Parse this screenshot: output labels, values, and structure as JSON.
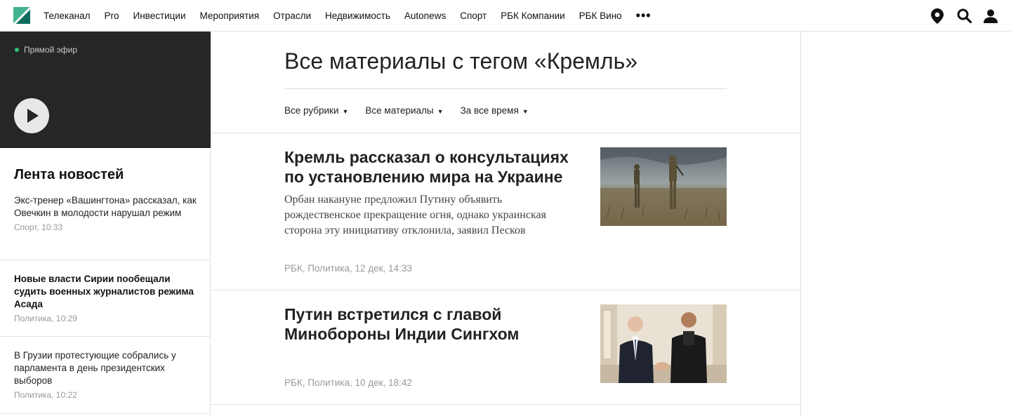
{
  "nav": {
    "items": [
      "Телеканал",
      "Pro",
      "Инвестиции",
      "Мероприятия",
      "Отрасли",
      "Недвижимость",
      "Autonews",
      "Спорт",
      "РБК Компании",
      "РБК Вино"
    ],
    "more": "•••"
  },
  "live": {
    "label": "Прямой эфир"
  },
  "feed": {
    "title": "Лента новостей",
    "items": [
      {
        "title": "Экс-тренер «Вашингтона» рассказал, как Овечкин в молодости нарушал режим",
        "meta": "Спорт, 10:33",
        "bold": false
      },
      {
        "title": "Новые власти Сирии пообещали судить военных журналистов режима Асада",
        "meta": "Политика, 10:29",
        "bold": true
      },
      {
        "title": "В Грузии протестующие собрались у парламента в день президентских выборов",
        "meta": "Политика, 10:22",
        "bold": false
      }
    ]
  },
  "main": {
    "title": "Все материалы с тегом «Кремль»",
    "filters": [
      "Все рубрики",
      "Все материалы",
      "За все время"
    ],
    "articles": [
      {
        "title": "Кремль рассказал о консультациях по установлению мира на Украине",
        "description": "Орбан накануне предложил Путину объявить рождественское прекращение огня, однако украинская сторона эту инициативу отклонила, заявил Песков",
        "meta": "РБК, Политика, 12 дек, 14:33"
      },
      {
        "title": "Путин встретился с главой Минобороны Индии Сингхом",
        "description": "",
        "meta": "РБК, Политика, 10 дек, 18:42"
      }
    ]
  }
}
